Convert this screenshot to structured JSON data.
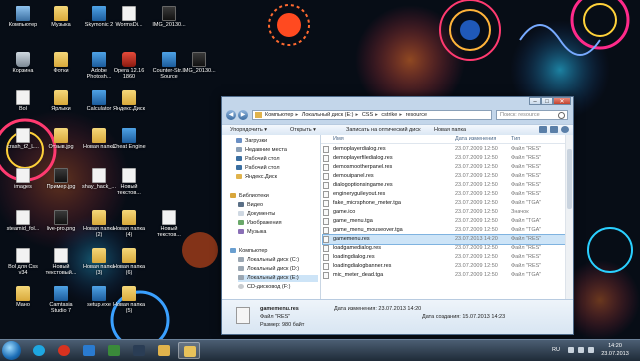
{
  "desktop": {
    "icons": [
      {
        "label": "Компьютер",
        "icon": "computer-icon"
      },
      {
        "label": "Музыка",
        "icon": "folder-icon"
      },
      {
        "label": "Skymonic 2",
        "icon": "app-icon"
      },
      {
        "label": "WormsDi...",
        "icon": "document-icon"
      },
      {
        "label": "IMG_20130...",
        "icon": "image-icon"
      },
      {
        "label": "Корзина",
        "icon": "recycle-bin-icon"
      },
      {
        "label": "Фотки",
        "icon": "folder-icon"
      },
      {
        "label": "Adobe Photosh...",
        "icon": "app-icon"
      },
      {
        "label": "Opera 12.16 1860",
        "icon": "opera-icon"
      },
      {
        "label": "Counter-Str... Source",
        "icon": "app-icon"
      },
      {
        "label": "IMG_20130...",
        "icon": "image-icon"
      },
      {
        "label": "Bol",
        "icon": "document-icon"
      },
      {
        "label": "Ярлыки",
        "icon": "folder-icon"
      },
      {
        "label": "Calculator",
        "icon": "app-icon"
      },
      {
        "label": "Яндекс.Диск",
        "icon": "folder-icon"
      },
      {
        "label": "crash_t2_L...",
        "icon": "document-icon"
      },
      {
        "label": "Отзыв.jpg",
        "icon": "folder-icon"
      },
      {
        "label": "Новая папка",
        "icon": "folder-icon"
      },
      {
        "label": "Cheat Engine",
        "icon": "app-icon"
      },
      {
        "label": "images",
        "icon": "document-icon"
      },
      {
        "label": "Пример.jpg",
        "icon": "image-icon"
      },
      {
        "label": "shay_hack_...",
        "icon": "document-icon"
      },
      {
        "label": "Новый текстов...",
        "icon": "document-icon"
      },
      {
        "label": "steamid_fol...",
        "icon": "document-icon"
      },
      {
        "label": "live-pro.png",
        "icon": "image-icon"
      },
      {
        "label": "Новая папка (2)",
        "icon": "folder-icon"
      },
      {
        "label": "Новая папка (4)",
        "icon": "folder-icon"
      },
      {
        "label": "Новый текстов...",
        "icon": "document-icon"
      },
      {
        "label": "Bol для Css v34",
        "icon": "document-icon"
      },
      {
        "label": "Новый текстовый...",
        "icon": "document-icon"
      },
      {
        "label": "Новая папка (3)",
        "icon": "folder-icon"
      },
      {
        "label": "Новая папка (6)",
        "icon": "folder-icon"
      },
      {
        "label": "Мано",
        "icon": "folder-icon"
      },
      {
        "label": "Camtasia Studio 7",
        "icon": "app-icon"
      },
      {
        "label": "setup.exe",
        "icon": "app-icon"
      },
      {
        "label": "Новая папка (5)",
        "icon": "folder-icon"
      }
    ]
  },
  "explorer": {
    "breadcrumb": [
      "Компьютер",
      "Локальный диск (E:)",
      "CSS",
      "cstrike",
      "resource"
    ],
    "search_placeholder": "Поиск: resource",
    "toolbar": {
      "organize": "Упорядочить ▾",
      "open": "Открыть ▾",
      "burn": "Записать на оптический диск",
      "new_folder": "Новая папка"
    },
    "nav": {
      "favorites": [
        "Загрузки",
        "Недавние места",
        "Рабочий стол",
        "Рабочий стол",
        "Яндекс.Диск"
      ],
      "libraries_title": "Библиотеки",
      "libraries": [
        "Видео",
        "Документы",
        "Изображения",
        "Музыка"
      ],
      "computer_title": "Компьютер",
      "drives": [
        "Локальный диск (C:)",
        "Локальный диск (D:)",
        "Локальный диск (E:)",
        "CD-дисковод (F:)"
      ],
      "selected_drive_index": 2
    },
    "columns": {
      "name": "Имя",
      "date": "Дата изменения",
      "type": "Тип"
    },
    "files": [
      {
        "name": "demoplayerdialog.res",
        "date": "23.07.2009 12:50",
        "type": "Файл \"RES\""
      },
      {
        "name": "demoplayerfiledialog.res",
        "date": "23.07.2009 12:50",
        "type": "Файл \"RES\""
      },
      {
        "name": "demosmootherpanel.res",
        "date": "23.07.2009 12:50",
        "type": "Файл \"RES\""
      },
      {
        "name": "demouipanel.res",
        "date": "23.07.2009 12:50",
        "type": "Файл \"RES\""
      },
      {
        "name": "dialogoptionsingame.res",
        "date": "23.07.2009 12:50",
        "type": "Файл \"RES\""
      },
      {
        "name": "engineryguileyout.res",
        "date": "23.07.2009 12:50",
        "type": "Файл \"RES\""
      },
      {
        "name": "fake_micrsphone_meter.tga",
        "date": "23.07.2009 12:50",
        "type": "Файл \"TGA\""
      },
      {
        "name": "game.ico",
        "date": "23.07.2009 12:50",
        "type": "Значок"
      },
      {
        "name": "game_menu.tga",
        "date": "23.07.2009 12:50",
        "type": "Файл \"TGA\""
      },
      {
        "name": "game_menu_mouseover.tga",
        "date": "23.07.2009 12:50",
        "type": "Файл \"TGA\""
      },
      {
        "name": "gamemenu.res",
        "date": "23.07.2013 14:20",
        "type": "Файл \"RES\""
      },
      {
        "name": "loadgamedialog.res",
        "date": "23.07.2009 12:50",
        "type": "Файл \"RES\""
      },
      {
        "name": "loadingdialog.res",
        "date": "23.07.2009 12:50",
        "type": "Файл \"RES\""
      },
      {
        "name": "loadingdialogbanner.res",
        "date": "23.07.2009 12:50",
        "type": "Файл \"RES\""
      },
      {
        "name": "mic_meter_dead.tga",
        "date": "23.07.2009 12:50",
        "type": "Файл \"TGA\""
      }
    ],
    "selected_file_index": 10,
    "details": {
      "name": "gamemenu.res",
      "modified_label": "Дата изменения: 23.07.2013 14:20",
      "type_label": "Файл \"RES\"",
      "size_label": "Размер: 980 байт",
      "created_label": "Дата создания: 15.07.2013 14:23"
    }
  },
  "taskbar": {
    "apps": [
      "skype-icon",
      "opera-icon",
      "media-player-icon",
      "camtasia-icon",
      "steam-icon",
      "explorer-icon",
      "folder-icon"
    ],
    "active_app_index": 6,
    "language": "RU",
    "time": "14:20",
    "date": "23.07.2013"
  }
}
